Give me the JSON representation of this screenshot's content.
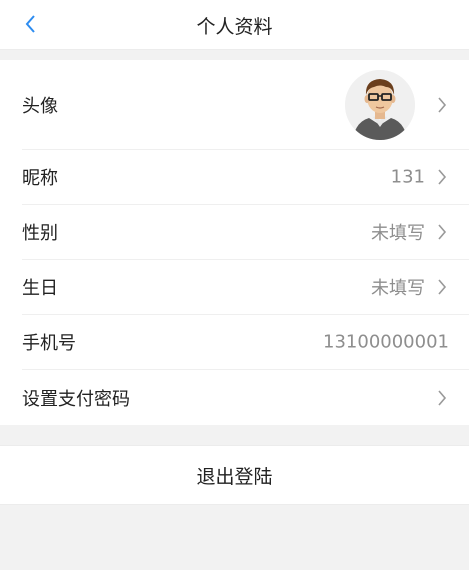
{
  "header": {
    "title": "个人资料",
    "back_icon": "chevron-left-icon"
  },
  "profile": {
    "avatar_label": "头像",
    "nickname_label": "昵称",
    "nickname_value": "131",
    "gender_label": "性别",
    "gender_value": "未填写",
    "birthday_label": "生日",
    "birthday_value": "未填写",
    "phone_label": "手机号",
    "phone_value": "13100000001",
    "payment_password_label": "设置支付密码"
  },
  "logout_label": "退出登陆",
  "colors": {
    "back_icon": "#2d8cf0",
    "value_text": "#8e8e8e",
    "chevron": "#999999",
    "background": "#f2f2f2"
  }
}
